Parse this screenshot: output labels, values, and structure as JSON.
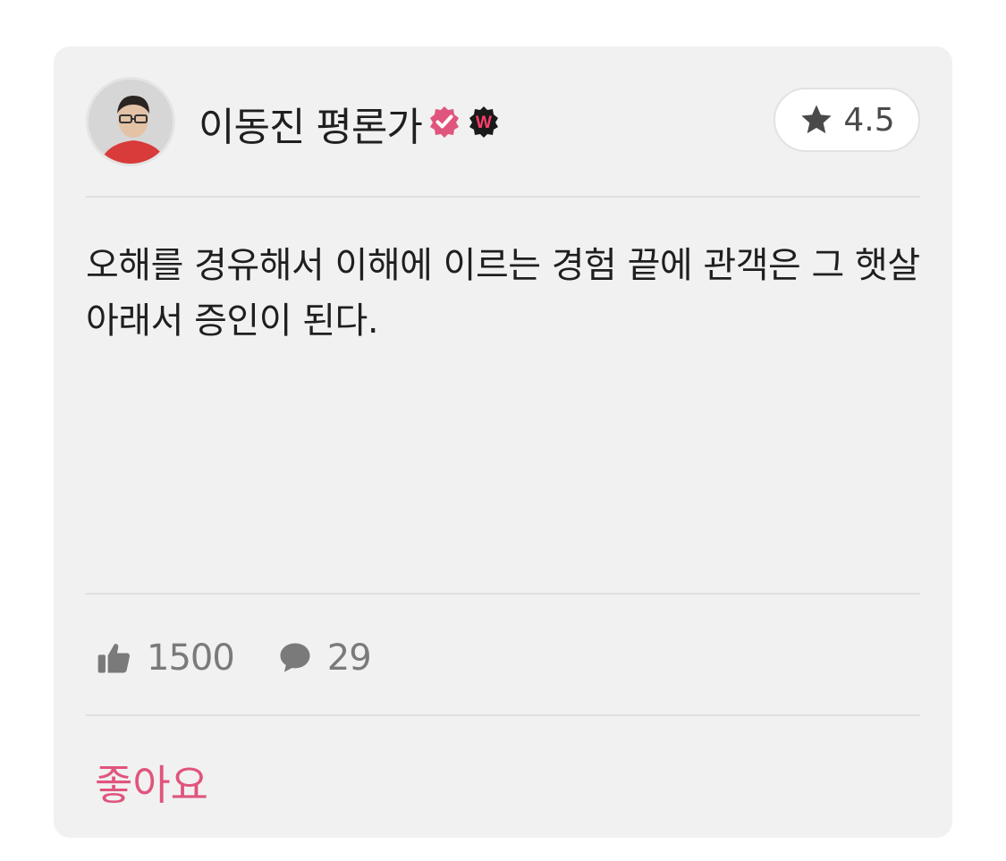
{
  "review": {
    "author": "이동진 평론가",
    "rating": "4.5",
    "text": "오해를 경유해서 이해에 이르는 경험 끝에 관객은 그 햇살 아래서 증인이 된다.",
    "likes": "1500",
    "comments": "29",
    "like_button_label": "좋아요",
    "badge_letter": "W"
  },
  "icons": {
    "verified": "verified-check-icon",
    "watcha": "watcha-badge-icon",
    "star": "star-icon",
    "thumbs_up": "thumbs-up-icon",
    "comment": "comment-bubble-icon"
  },
  "colors": {
    "accent": "#e0557d",
    "card_bg": "#f1f1f1",
    "muted": "#7a7a7a"
  }
}
